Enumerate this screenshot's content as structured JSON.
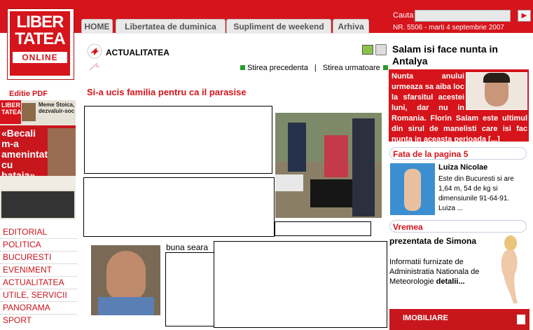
{
  "header": {
    "logo": {
      "line1": "LIBER",
      "line2": "TATEA",
      "line3": "ONLINE"
    },
    "tabs": [
      "HOME",
      "Libertatea de duminica",
      "Supliment de weekend",
      "Arhiva"
    ],
    "search_label": "Cauta",
    "search_value": "",
    "issue_date": "NR. 5506 - marti 4 septembrie 2007"
  },
  "sidebar": {
    "editie_pdf": "Editie PDF",
    "cover": {
      "brand": "LIBER TATEA",
      "teaser": "Meme Stoica, dezvaluir-soc",
      "headline": "«Becali m-a amenintat cu bataia»"
    },
    "nav_items": [
      "EDITORIAL",
      "POLITICA",
      "BUCURESTI",
      "EVENIMENT",
      "ACTUALITATEA",
      "UTILE, SERVICII",
      "PANORAMA",
      "SPORT"
    ]
  },
  "main": {
    "section_title": "ACTUALITATEA",
    "prev_label": "Stirea precedenta",
    "separator": "|",
    "next_label": "Stirea urmatoare",
    "headline": "Si-a ucis familia pentru ca il parasise",
    "body_start": "buna seara"
  },
  "right": {
    "feature_title": "Salam isi face nunta in Antalya",
    "feature_text": "Nunta anului urmeaza sa aiba loc la sfarsitul acestei luni, dar nu in Romania. Florin Salam este ultimul din sirul de manelisti care isi fac nunta in aceasta perioada [...]",
    "fata_title": "Fata de la pagina 5",
    "fata_name": "Luiza Nicolae",
    "fata_text": "Este din Bucuresti si are 1,64 m, 54 de kg si dimensiunile 91-64-91. Luiza ...",
    "vremea_title": "Vremea",
    "vremea_sub": "prezentata de Simona",
    "vremea_text": "Informatii furnizate de Administratia Nationala de Meteorologie",
    "vremea_link": "detalii...",
    "imobiliare": "IMOBILIARE"
  },
  "colors": {
    "brand_red": "#d6141b",
    "nav_red": "#c8161d",
    "link_green": "#2a9b2a"
  }
}
